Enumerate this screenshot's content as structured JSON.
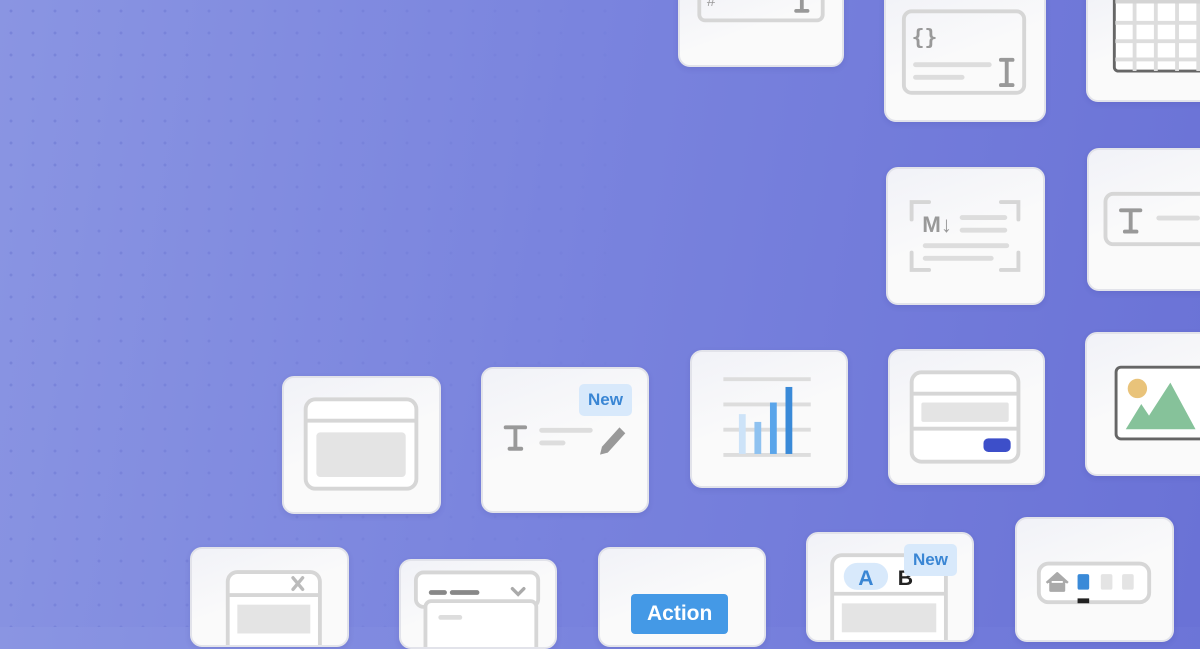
{
  "tiles": {
    "text_edit": {
      "badge": "New"
    },
    "tabs": {
      "badge": "New",
      "tab_a": "A",
      "tab_b": "B"
    },
    "button": {
      "label": "Action"
    },
    "markdown": {
      "glyph": "M↓"
    },
    "code": {
      "glyph": "{}"
    }
  },
  "colors": {
    "background_left": "#8a95e2",
    "background_right": "#6a72d6",
    "accent_blue": "#4499e6",
    "badge_bg": "#d8e9fb",
    "form_button": "#3d4fc9",
    "sun": "#e9c37a",
    "mountain": "#86c29a"
  },
  "icons": [
    "number-input-icon",
    "code-input-icon",
    "table-icon",
    "markdown-icon",
    "text-input-icon",
    "card-icon",
    "text-edit-icon",
    "bar-chart-icon",
    "form-icon",
    "image-icon",
    "dialog-icon",
    "dropdown-icon",
    "button-icon",
    "tabs-icon",
    "breadcrumb-icon"
  ]
}
